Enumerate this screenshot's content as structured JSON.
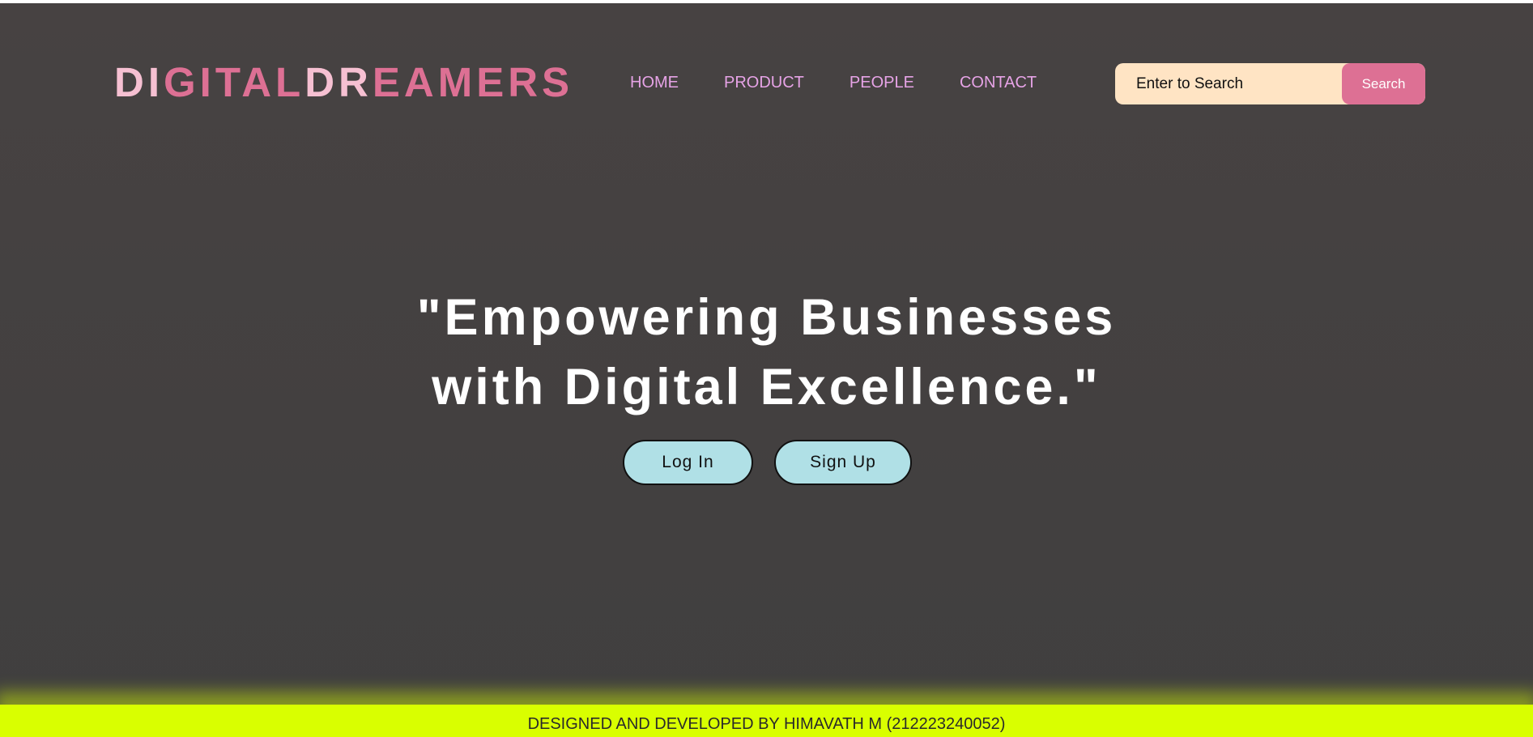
{
  "header": {
    "logo": {
      "segments": [
        {
          "text": "DI",
          "color": "#f6c0d2"
        },
        {
          "text": "GITAL",
          "color": "#dd7094"
        },
        {
          "text": "DR",
          "color": "#f6c0d2"
        },
        {
          "text": "EAMERS",
          "color": "#dd7094"
        }
      ]
    },
    "nav": {
      "color": "#e6a3e6",
      "items": [
        {
          "label": "HOME"
        },
        {
          "label": "PRODUCT"
        },
        {
          "label": "PEOPLE"
        },
        {
          "label": "CONTACT"
        }
      ]
    },
    "search": {
      "placeholder": "Enter to Search",
      "button_label": "Search",
      "input_bg": "#ffe4c4",
      "button_bg": "#dd7094"
    }
  },
  "hero": {
    "title_line1": "\"Empowering Businesses",
    "title_line2": "with Digital Excellence.\"",
    "login_label": "Log In",
    "signup_label": "Sign Up",
    "button_bg": "#b0e0e6"
  },
  "footer": {
    "text": "DESIGNED AND DEVELOPED BY HIMAVATH M (212223240052)",
    "bg": "#d9ff00"
  },
  "theme": {
    "page_bg": "#444141",
    "hero_text": "#ffffff"
  }
}
